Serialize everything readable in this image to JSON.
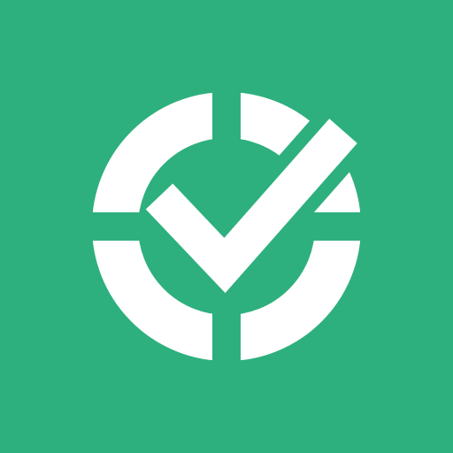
{
  "icon": {
    "name": "checkmark-in-segmented-ring-icon",
    "background_color": "#2db07e",
    "foreground_color": "#ffffff"
  }
}
